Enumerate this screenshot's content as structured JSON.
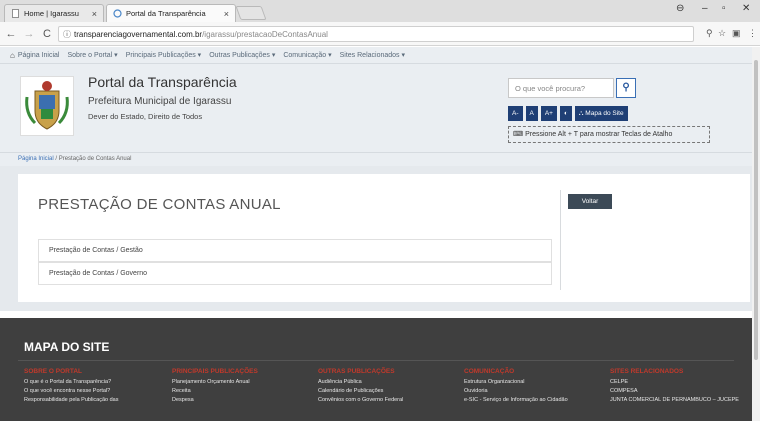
{
  "browser": {
    "tabs": [
      {
        "title": "Home | Igarassu"
      },
      {
        "title": "Portal da Transparência"
      }
    ],
    "url_host": "transparenciagovernamental.com.br",
    "url_path": "/igarassu/prestacaoDeContasAnual"
  },
  "sitenav": {
    "items": [
      "Página Inicial",
      "Sobre o Portal ▾",
      "Principais Publicações ▾",
      "Outras Publicações ▾",
      "Comunicação ▾",
      "Sites Relacionados ▾"
    ]
  },
  "header": {
    "title": "Portal da Transparência",
    "subtitle": "Prefeitura Municipal de Igarassu",
    "motto": "Dever do Estado, Direito de Todos",
    "search_placeholder": "O que você procura?",
    "a11y_buttons": [
      "A-",
      "A",
      "A+",
      "◐",
      "Mapa do Site"
    ],
    "shortcut_hint": "Pressione Alt + T para mostrar Teclas de Atalho"
  },
  "breadcrumb": {
    "home": "Página Inicial",
    "separator": "/",
    "current": "Prestação de Contas Anual"
  },
  "main": {
    "title": "PRESTAÇÃO DE CONTAS ANUAL",
    "back_label": "Voltar",
    "items": [
      "Prestação de Contas / Gestão",
      "Prestação de Contas / Governo"
    ]
  },
  "footer": {
    "title": "MAPA DO SITE",
    "columns": [
      {
        "heading": "SOBRE O PORTAL",
        "links": [
          "O que é o Portal da Transparência?",
          "O que você encontra nesse Portal?",
          "Responsabilidade pela Publicação das"
        ]
      },
      {
        "heading": "PRINCIPAIS PUBLICAÇÕES",
        "links": [
          "Planejamento Orçamento Anual",
          "Receita",
          "Despesa"
        ]
      },
      {
        "heading": "OUTRAS PUBLICAÇÕES",
        "links": [
          "Audiência Pública",
          "Calendário de Publicações",
          "Convênios com o Governo Federal"
        ]
      },
      {
        "heading": "COMUNICAÇÃO",
        "links": [
          "Estrutura Organizacional",
          "Ouvidoria",
          "e-SIC - Serviço de Informação ao Cidadão"
        ]
      },
      {
        "heading": "SITES RELACIONADOS",
        "links": [
          "CELPE",
          "COMPESA",
          "JUNTA COMERCIAL DE PERNAMBUCO – JUCEPE"
        ]
      }
    ]
  },
  "colors": {
    "accent": "#1f3f75",
    "footer_bg": "#3f3f3f",
    "footer_heading": "#c0392b",
    "back_button": "#3c4a57"
  }
}
